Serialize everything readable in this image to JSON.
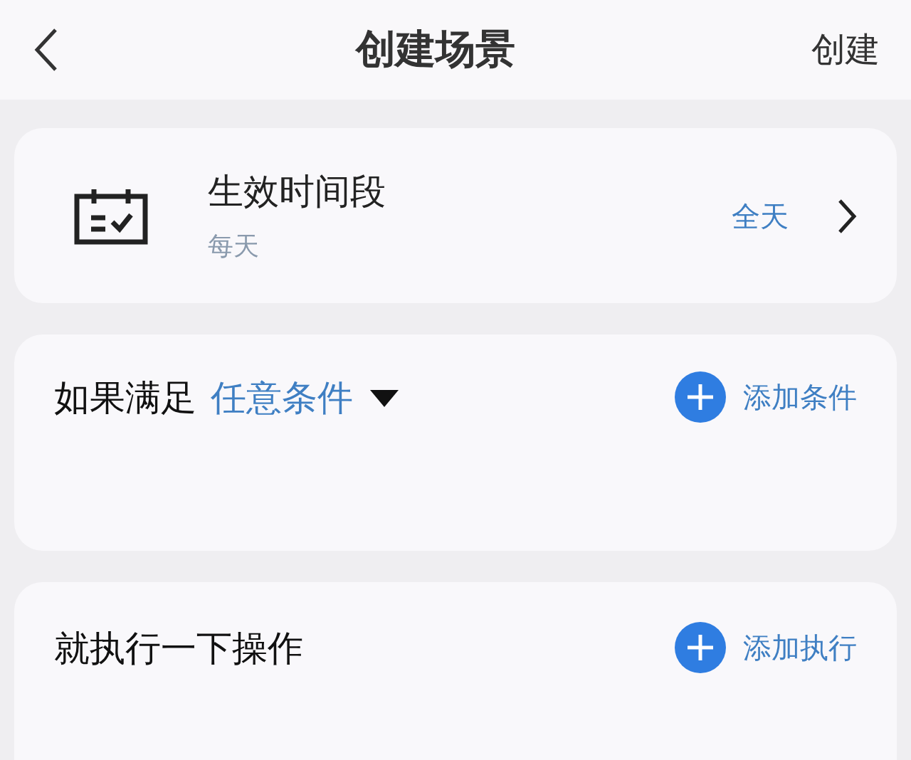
{
  "header": {
    "title": "创建场景",
    "action": "创建"
  },
  "period": {
    "title": "生效时间段",
    "subtitle": "每天",
    "value": "全天"
  },
  "condition": {
    "label": "如果满足",
    "selector": "任意条件",
    "add": "添加条件"
  },
  "action": {
    "label": "就执行一下操作",
    "add": "添加执行"
  }
}
